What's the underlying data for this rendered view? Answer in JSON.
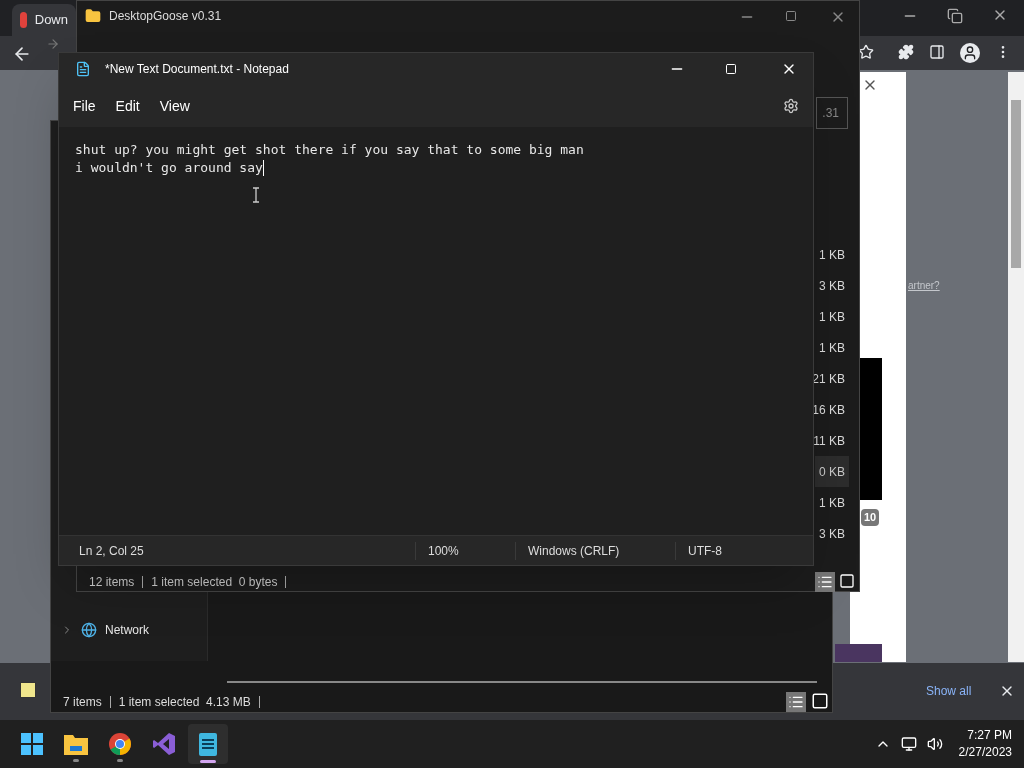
{
  "browser": {
    "tab_title": "Down",
    "download_bar": {
      "action": "Show all"
    },
    "page_badge": "10",
    "page_link": "artner?"
  },
  "goose_window": {
    "title": "DesktopGoose v0.31",
    "field_value": ".31",
    "sizes": [
      {
        "text": "1 KB",
        "selected": false
      },
      {
        "text": "3 KB",
        "selected": false
      },
      {
        "text": "1 KB",
        "selected": false
      },
      {
        "text": "1 KB",
        "selected": false
      },
      {
        "text": "21 KB",
        "selected": false
      },
      {
        "text": "16 KB",
        "selected": false
      },
      {
        "text": "11 KB",
        "selected": false
      },
      {
        "text": "0 KB",
        "selected": true
      },
      {
        "text": "1 KB",
        "selected": false
      },
      {
        "text": "3 KB",
        "selected": false
      }
    ],
    "status": [
      "12 items",
      "1 item selected  0 bytes"
    ]
  },
  "explorer_window": {
    "sidebar": [
      {
        "label": "Network",
        "expanded": false
      }
    ],
    "status": [
      "7 items",
      "1 item selected  4.13 MB"
    ]
  },
  "notepad": {
    "title": "*New Text Document.txt - Notepad",
    "menu": [
      "File",
      "Edit",
      "View"
    ],
    "lines": [
      "shut up? you might get shot there if you say that to some big man",
      "i wouldn't go around say"
    ],
    "status": [
      "Ln 2, Col 25",
      "100%",
      "Windows (CRLF)",
      "UTF-8"
    ]
  },
  "taskbar": {
    "apps": [
      {
        "kind": "start",
        "selected": false
      },
      {
        "kind": "explorer",
        "selected": false
      },
      {
        "kind": "chrome",
        "selected": false
      },
      {
        "kind": "studio",
        "selected": false
      },
      {
        "kind": "notepad",
        "selected": true
      }
    ],
    "time": "7:27 PM",
    "date": "2/27/2023"
  }
}
